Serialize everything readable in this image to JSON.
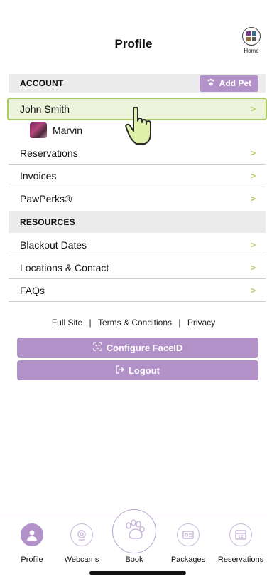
{
  "header": {
    "title": "Profile",
    "home_label": "Home"
  },
  "account": {
    "section_title": "ACCOUNT",
    "add_pet_label": "Add Pet",
    "user_name": "John Smith",
    "pet_name": "Marvin",
    "items": [
      "Reservations",
      "Invoices",
      "PawPerks®"
    ]
  },
  "resources": {
    "section_title": "RESOURCES",
    "items": [
      "Blackout Dates",
      "Locations & Contact",
      "FAQs"
    ]
  },
  "footer": {
    "full_site": "Full Site",
    "sep1": "|",
    "terms": "Terms & Conditions",
    "sep2": "|",
    "privacy": "Privacy"
  },
  "actions": {
    "faceid_label": "Configure FaceID",
    "logout_label": "Logout"
  },
  "tabbar": {
    "tabs": [
      "Profile",
      "Webcams",
      "Book",
      "Packages",
      "Reservations"
    ],
    "active": "Profile"
  },
  "colors": {
    "accent": "#b391c9",
    "chevron": "#a8c75a",
    "highlight": "#eef4dc",
    "highlight_border": "#a9c962"
  },
  "icons": {
    "add_pet": "paw-icon",
    "faceid": "faceid-icon",
    "logout": "logout-icon",
    "cursor": "pointing-hand-icon"
  }
}
